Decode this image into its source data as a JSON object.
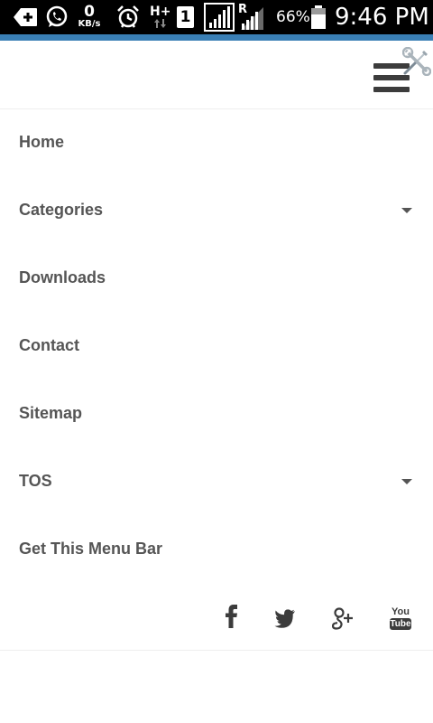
{
  "status_bar": {
    "data_speed_value": "0",
    "data_speed_unit": "KB/s",
    "network_type": "H+",
    "sim_slot": "1",
    "roaming": "R",
    "battery_percent": "66%",
    "time": "9:46 PM",
    "accent_color": "#3a7fb5"
  },
  "header": {
    "menu_icon": "hamburger-icon",
    "tools_icon": "tools-icon"
  },
  "menu": {
    "items": [
      {
        "label": "Home",
        "has_submenu": false
      },
      {
        "label": "Categories",
        "has_submenu": true
      },
      {
        "label": "Downloads",
        "has_submenu": false
      },
      {
        "label": "Contact",
        "has_submenu": false
      },
      {
        "label": "Sitemap",
        "has_submenu": false
      },
      {
        "label": "TOS",
        "has_submenu": true
      },
      {
        "label": "Get This Menu Bar",
        "has_submenu": false
      }
    ]
  },
  "social": [
    "facebook-icon",
    "twitter-icon",
    "google-plus-icon",
    "youtube-icon"
  ],
  "social_youtube_text_1": "You",
  "social_youtube_text_2": "Tube",
  "colors": {
    "menu_text": "#555555",
    "icon": "#3c3c3c"
  }
}
